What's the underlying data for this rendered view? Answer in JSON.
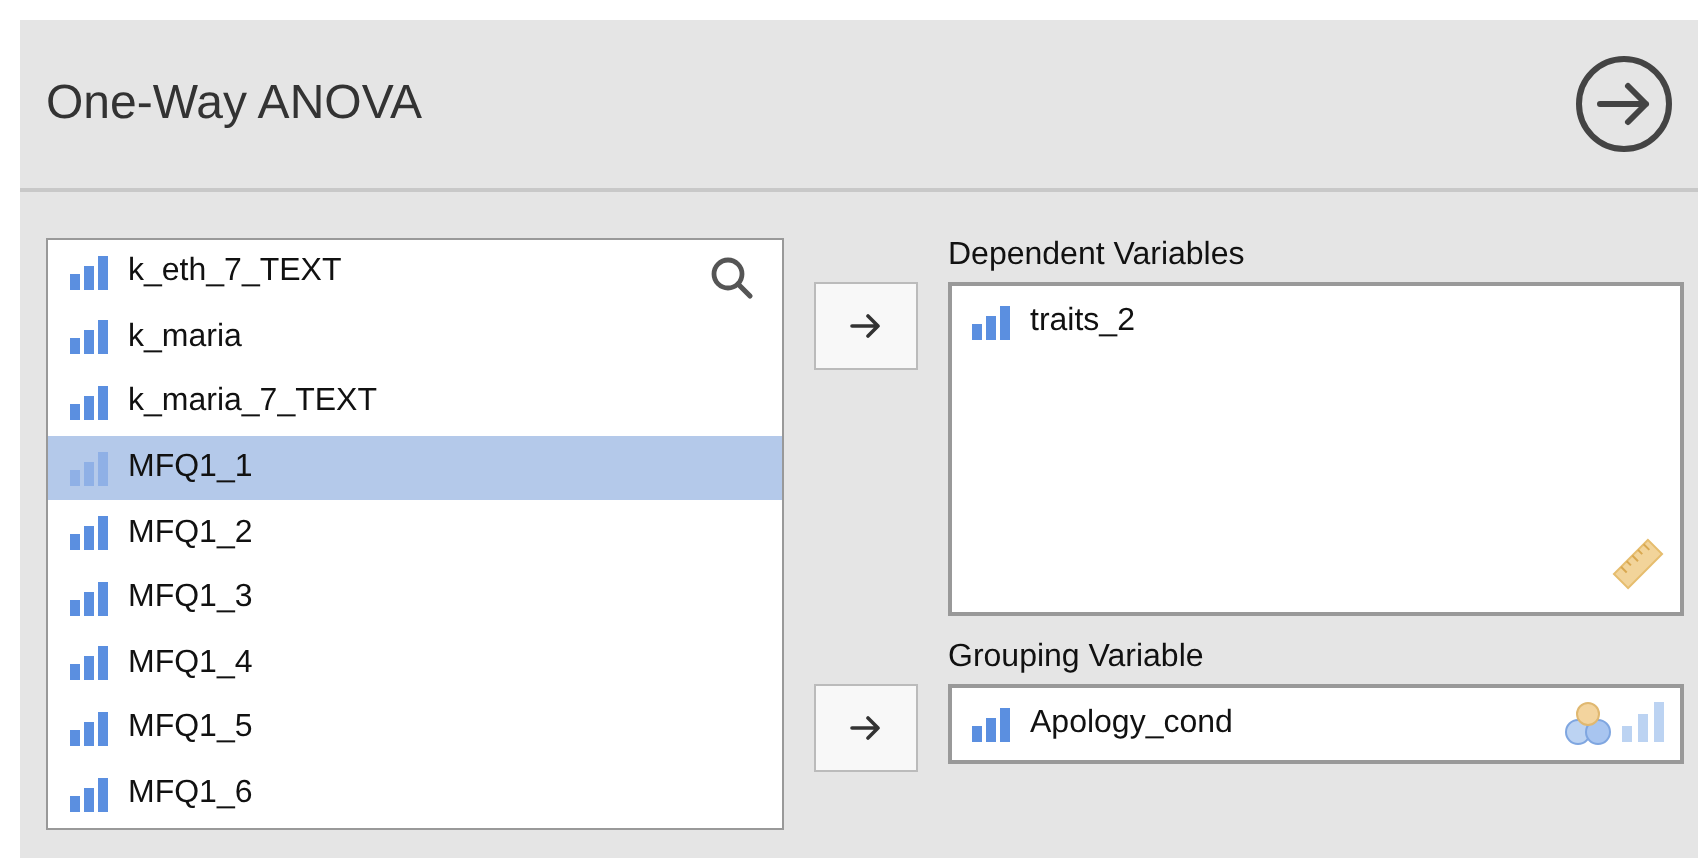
{
  "title": "One-Way ANOVA",
  "variables": [
    {
      "name": "k_eth_7_TEXT",
      "selected": false
    },
    {
      "name": "k_maria",
      "selected": false
    },
    {
      "name": "k_maria_7_TEXT",
      "selected": false
    },
    {
      "name": "MFQ1_1",
      "selected": true
    },
    {
      "name": "MFQ1_2",
      "selected": false
    },
    {
      "name": "MFQ1_3",
      "selected": false
    },
    {
      "name": "MFQ1_4",
      "selected": false
    },
    {
      "name": "MFQ1_5",
      "selected": false
    },
    {
      "name": "MFQ1_6",
      "selected": false
    }
  ],
  "targets": [
    {
      "label": "Dependent Variables",
      "kind": "multi",
      "items": [
        "traits_2"
      ]
    },
    {
      "label": "Grouping Variable",
      "kind": "single",
      "items": [
        "Apology_cond"
      ]
    }
  ]
}
